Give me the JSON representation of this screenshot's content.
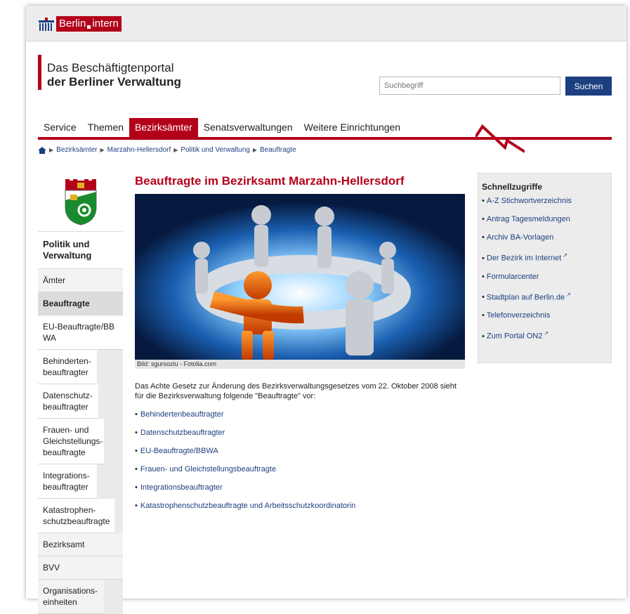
{
  "logo": {
    "word1": "Berlin",
    "word2": "intern"
  },
  "portal": {
    "line1": "Das Beschäftigtenportal",
    "line2": "der Berliner Verwaltung"
  },
  "search": {
    "placeholder": "Suchbegriff",
    "button": "Suchen"
  },
  "nav": [
    "Service",
    "Themen",
    "Bezirksämter",
    "Senatsverwaltungen",
    "Weitere Einrichtungen"
  ],
  "breadcrumb": [
    "Bezirksämter",
    "Marzahn-Hellersdorf",
    "Politik und Verwaltung",
    "Beauftragte"
  ],
  "leftnav": {
    "heading": "Politik und Verwaltung",
    "items": [
      "Ämter",
      "Beauftragte",
      "EU-Beauftragte/BBWA",
      "Behinderten-beauftragter",
      "Datenschutz-beauftragter",
      "Frauen- und Gleichstellungs-beauftragte",
      "Integrations-beauftragter",
      "Katastrophen-schutzbeauftragte",
      "Bezirksamt",
      "BVV",
      "Organisations-einheiten"
    ]
  },
  "main": {
    "title": "Beauftragte im Bezirksamt Marzahn-Hellersdorf",
    "caption": "Bild: sgursozlu - Fotolia.com",
    "intro": "Das Achte Gesetz zur Änderung des Bezirksverwaltungsgesetzes vom 22. Oktober 2008 sieht für die Bezirksverwaltung folgende \"Beauftragte\" vor:",
    "links": [
      "Behindertenbeauftragter",
      "Datenschutzbeauftragter",
      "EU-Beauftragte/BBWA",
      "Frauen- und Gleichstellungsbeauftragte",
      "Integrationsbeauftragter",
      "Katastrophenschutzbeauftragte und Arbeitsschutzkoordinatorin"
    ]
  },
  "quick": {
    "title": "Schnellzugriffe",
    "items": [
      "A-Z Stichwortverzeichnis",
      "Antrag Tagesmeldungen",
      "Archiv BA-Vorlagen",
      "Der Bezirk im Internet",
      "Formularcenter",
      "Stadtplan auf Berlin.de",
      "Telefonverzeichnis",
      "Zum Portal ON2"
    ]
  },
  "colors": {
    "brand_red": "#b3011a",
    "link_blue": "#1c3f80",
    "button_blue": "#1c3f80"
  }
}
